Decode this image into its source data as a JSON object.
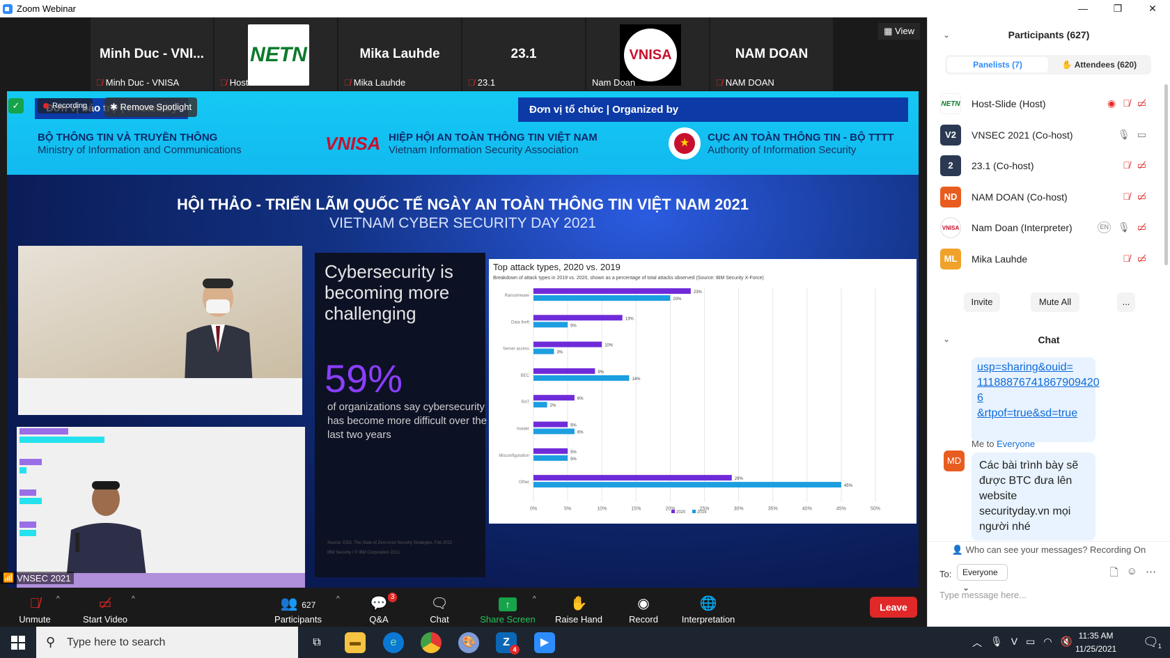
{
  "window": {
    "title": "Zoom Webinar",
    "min": "—",
    "restore": "❐",
    "close": "✕"
  },
  "video_strip": {
    "tiles": [
      {
        "big": "Minh Duc - VNI...",
        "label": "Minh Duc - VNISA",
        "muted": true
      },
      {
        "big": "",
        "label": "Host-Slide",
        "muted": true,
        "logo": "NETN"
      },
      {
        "big": "Mika Lauhde",
        "label": "Mika Lauhde",
        "muted": true
      },
      {
        "big": "23.1",
        "label": "23.1",
        "muted": true
      },
      {
        "big": "",
        "label": "Nam Doan",
        "muted": false,
        "logo": "VNISA"
      },
      {
        "big": "NAM DOAN",
        "label": "NAM DOAN",
        "muted": true
      }
    ],
    "view_label": "View"
  },
  "share": {
    "recording": "Recording",
    "remove_spotlight": "Remove Spotlight",
    "hosted_by": "Đơn vị bảo trợ | Hosted by",
    "organized_by": "Đơn vị tổ chức | Organized by",
    "org1_vn": "BỘ THÔNG TIN VÀ TRUYỀN THÔNG",
    "org1_en": "Ministry of Information and Communications",
    "org2_logo": "VNISA",
    "org2_vn": "HIỆP HỘI AN TOÀN THÔNG TIN VIỆT NAM",
    "org2_en": "Vietnam Information Security Association",
    "org3_vn": "CỤC AN TOÀN THÔNG TIN - BỘ TTTT",
    "org3_en": "Authority of Information Security",
    "headline_vn": "HỘI THẢO - TRIỂN LÃM QUỐC TẾ NGÀY AN TOÀN THÔNG TIN VIỆT NAM 2021",
    "headline_en": "VIETNAM CYBER SECURITY DAY 2021",
    "slide_heading": "Cybersecurity is becoming more challenging",
    "big_pct": "59%",
    "pct_text": "of organizations say cybersecurity has become more difficult over the last two years",
    "source": "Source: ESG, The State of Zero-trust Security Strategies, Feb 2022",
    "copyright": "IBM Security / © IBM Corporation 2021",
    "cam_label": "VNSEC 2021"
  },
  "chart_data": {
    "type": "bar",
    "title": "Top attack types, 2020 vs. 2019",
    "subtitle": "Breakdown of attack types in 2019 vs. 2020, shown as a percentage of total attacks observed (Source: IBM Security X-Force)",
    "categories": [
      "Ransomware",
      "Data theft",
      "Server access",
      "BEC",
      "RAT",
      "Insider",
      "Misconfiguration",
      "Other"
    ],
    "series": [
      {
        "name": "2020",
        "color": "#6f2bd9",
        "values": [
          23,
          13,
          10,
          9,
          6,
          5,
          5,
          29
        ]
      },
      {
        "name": "2019",
        "color": "#1c9ee0",
        "values": [
          20,
          5,
          3,
          14,
          2,
          6,
          5,
          45
        ]
      }
    ],
    "xlim": [
      0,
      50
    ],
    "ticks": [
      "0%",
      "5%",
      "10%",
      "15%",
      "20%",
      "25%",
      "30%",
      "35%",
      "40%",
      "45%",
      "50%"
    ],
    "value_labels_2020": [
      "23%",
      "13%",
      "10%",
      "9%",
      "6%",
      "5%",
      "5%",
      "29%"
    ],
    "value_labels_2019": [
      "20%",
      "5%",
      "3%",
      "14%",
      "2%",
      "6%",
      "5%",
      "45%"
    ],
    "legend": [
      "2020",
      "2019"
    ],
    "grid": true
  },
  "toolbar": {
    "unmute": "Unmute",
    "start_video": "Start Video",
    "participants": "Participants",
    "participants_count": "627",
    "qa": "Q&A",
    "qa_badge": "3",
    "chat": "Chat",
    "share_screen": "Share Screen",
    "raise_hand": "Raise Hand",
    "record": "Record",
    "interpretation": "Interpretation",
    "leave": "Leave"
  },
  "panel": {
    "title": "Participants (627)",
    "tab_panelists": "Panelists (7)",
    "tab_attendees": "Attendees (620)",
    "participants": [
      {
        "initials": "NETN",
        "name": "Host-Slide (Host)",
        "color": "#ffffff"
      },
      {
        "initials": "V2",
        "name": "VNSEC 2021 (Co-host)",
        "color": "#2b3a52"
      },
      {
        "initials": "2",
        "name": "23.1 (Co-host)",
        "color": "#2b3a52"
      },
      {
        "initials": "ND",
        "name": "NAM DOAN (Co-host)",
        "color": "#e85c1f"
      },
      {
        "initials": "VNISA",
        "name": "Nam Doan (Interpreter)",
        "color": "#ffffff"
      },
      {
        "initials": "ML",
        "name": "Mika Lauhde",
        "color": "#f0a22a"
      }
    ],
    "invite": "Invite",
    "mute_all": "Mute All",
    "more": "...",
    "chat_title": "Chat",
    "chat_link_lines": [
      "usp=sharing&ouid=",
      "11188876741867909420",
      "6",
      "&rtpof=true&sd=true"
    ],
    "me_to": "Me to",
    "everyone": "Everyone",
    "my_initials": "MD",
    "message": "Các bài trình bày sẽ được BTC đưa lên website securityday.vn mọi người nhé",
    "who_can_see": "Who can see your messages? Recording On",
    "to_label": "To:",
    "to_value": "Everyone",
    "placeholder": "Type message here..."
  },
  "taskbar": {
    "search_placeholder": "Type here to search",
    "time": "11:35 AM",
    "date": "11/25/2021",
    "notif_count": "1"
  }
}
